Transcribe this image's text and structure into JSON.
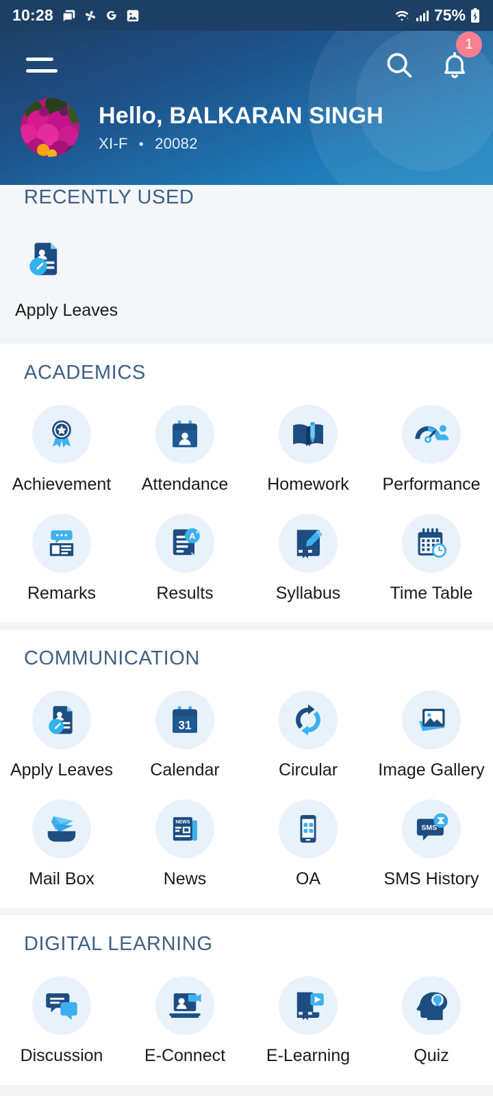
{
  "status_bar": {
    "time": "10:28",
    "battery_text": "75%",
    "left_icons": [
      "messages-icon",
      "pinwheel-icon",
      "google-icon",
      "photos-icon"
    ],
    "right_icons": [
      "wifi-icon",
      "signal-icon",
      "battery-charging-icon"
    ]
  },
  "header": {
    "menu_icon": "hamburger-menu-icon",
    "search_icon": "search-icon",
    "notification_icon": "bell-icon",
    "notification_badge": "1",
    "avatar": "user-avatar-flowers",
    "greeting": "Hello, BALKARAN SINGH",
    "class": "XI-F",
    "separator": "•",
    "roll_number": "20082",
    "gradient_from": "#1d3f66",
    "gradient_to": "#2189c4",
    "badge_color": "#fa8091"
  },
  "sections": [
    {
      "id": "recently-used",
      "title": "RECENTLY USED",
      "items": [
        {
          "label": "Apply Leaves",
          "icon": "apply-leaves-icon"
        }
      ]
    },
    {
      "id": "academics",
      "title": "ACADEMICS",
      "items": [
        {
          "label": "Achievement",
          "icon": "achievement-medal-icon"
        },
        {
          "label": "Attendance",
          "icon": "attendance-calendar-person-icon"
        },
        {
          "label": "Homework",
          "icon": "homework-book-pencil-icon"
        },
        {
          "label": "Performance",
          "icon": "performance-gauge-icon"
        },
        {
          "label": "Remarks",
          "icon": "remarks-comment-icon"
        },
        {
          "label": "Results",
          "icon": "results-aplus-icon"
        },
        {
          "label": "Syllabus",
          "icon": "syllabus-book-pen-icon"
        },
        {
          "label": "Time Table",
          "icon": "timetable-calendar-clock-icon"
        }
      ]
    },
    {
      "id": "communication",
      "title": "COMMUNICATION",
      "items": [
        {
          "label": "Apply Leaves",
          "icon": "apply-leaves-icon"
        },
        {
          "label": "Calendar",
          "icon": "calendar-31-icon"
        },
        {
          "label": "Circular",
          "icon": "circular-refresh-icon"
        },
        {
          "label": "Image Gallery",
          "icon": "image-gallery-icon"
        },
        {
          "label": "Mail Box",
          "icon": "mailbox-envelope-icon"
        },
        {
          "label": "News",
          "icon": "news-paper-icon"
        },
        {
          "label": "OA",
          "icon": "oa-mobile-icon"
        },
        {
          "label": "SMS History",
          "icon": "sms-history-icon"
        }
      ]
    },
    {
      "id": "digital-learning",
      "title": "DIGITAL LEARNING",
      "items": [
        {
          "label": "Discussion",
          "icon": "discussion-chat-icon"
        },
        {
          "label": "E-Connect",
          "icon": "econnect-laptop-video-icon"
        },
        {
          "label": "E-Learning",
          "icon": "elearning-book-play-icon"
        },
        {
          "label": "Quiz",
          "icon": "quiz-head-bulb-icon"
        }
      ]
    }
  ],
  "nav_bar": {
    "recents_label": "recents-button",
    "home_label": "home-button",
    "back_label": "back-button"
  },
  "theme": {
    "icon_dark": "#1d4d81",
    "icon_light": "#3fb0ef",
    "tile_bg": "#e9f2fb",
    "section_title": "#3d5f82"
  }
}
